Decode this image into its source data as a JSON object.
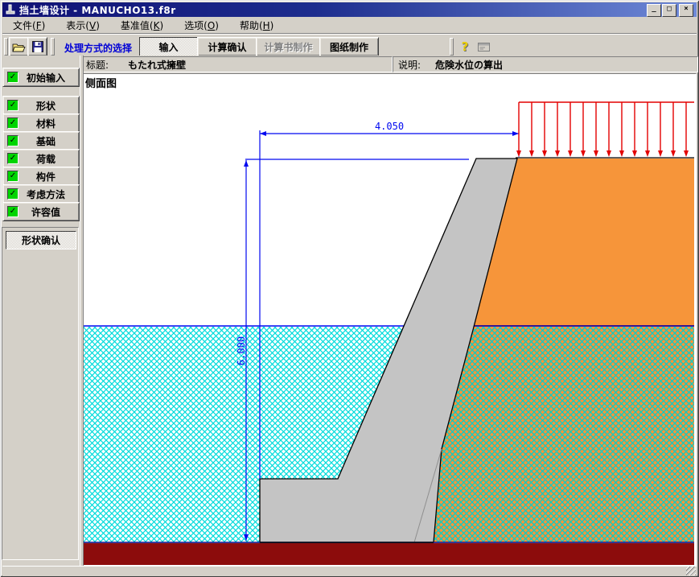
{
  "window": {
    "title": "挡土墙设计 - MANUCHO13.f8r",
    "controls": {
      "minimize_glyph": "_",
      "maximize_glyph": "□",
      "close_glyph": "×"
    }
  },
  "menu": {
    "items": [
      {
        "pre": "文件(",
        "key": "F",
        "post": ")"
      },
      {
        "pre": "表示(",
        "key": "V",
        "post": ")"
      },
      {
        "pre": "基准值(",
        "key": "K",
        "post": ")"
      },
      {
        "pre": "选项(",
        "key": "O",
        "post": ")"
      },
      {
        "pre": "帮助(",
        "key": "H",
        "post": ")"
      }
    ]
  },
  "toolbar": {
    "mode_select_label": "处理方式的选择",
    "help_glyph": "?",
    "buttons": [
      {
        "label": "输入",
        "state": "active"
      },
      {
        "label": "计算确认",
        "state": "normal"
      },
      {
        "label": "计算书制作",
        "state": "disabled"
      },
      {
        "label": "图纸制作",
        "state": "normal"
      }
    ]
  },
  "header": {
    "title_label": "标题:",
    "title_value": "もたれ式擁壁",
    "desc_label": "说明:",
    "desc_value": "危険水位の算出"
  },
  "sidebar": {
    "check_glyph": "✓",
    "nav_buttons": [
      {
        "label": "初始输入",
        "checked": true
      },
      {
        "label": "形状",
        "checked": true
      },
      {
        "label": "材料",
        "checked": true
      },
      {
        "label": "基础",
        "checked": true
      },
      {
        "label": "荷载",
        "checked": true
      },
      {
        "label": "构件",
        "checked": true
      },
      {
        "label": "考虑方法",
        "checked": true
      },
      {
        "label": "许容值",
        "checked": true
      }
    ],
    "confirm_label": "形状确认"
  },
  "drawing": {
    "view_label": "侧面图",
    "width_dim": "4.050",
    "height_dim": "6.000",
    "load_arrow_count": 14,
    "colors": {
      "wall": "#c4c4c4",
      "soil_dry": "#f6953a",
      "water_hatch": "#00dcdc",
      "base_layer": "#8c0c0c",
      "dimension_blue": "#0008f0",
      "load_red": "#e30000"
    }
  }
}
